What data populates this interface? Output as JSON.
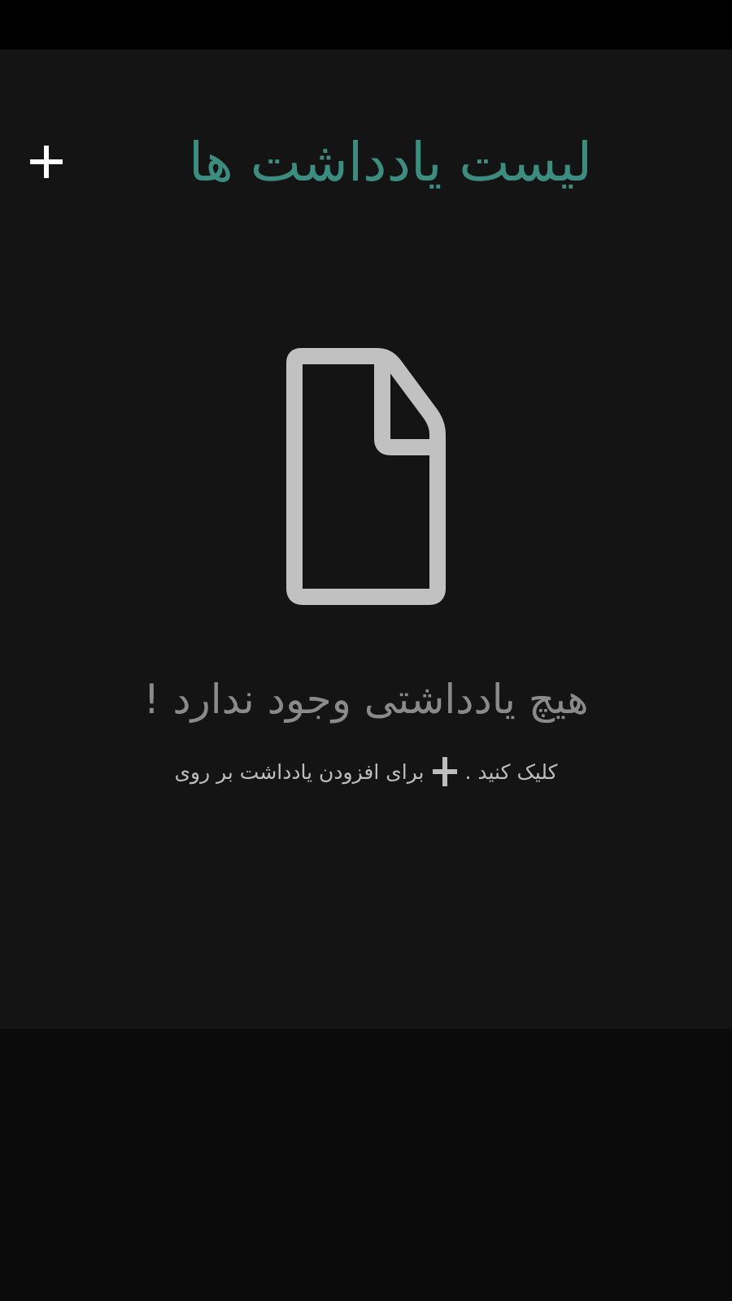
{
  "header": {
    "title": "لیست یادداشت ها",
    "title_color": "#3c8c80",
    "add_icon": "plus-icon"
  },
  "empty_state": {
    "icon": "file-icon",
    "title": "هیچ یادداشتی وجود ندارد !",
    "hint_before": "برای افزودن یادداشت بر روی",
    "hint_icon": "plus-icon",
    "hint_after": "کلیک کنید ."
  },
  "colors": {
    "background": "#141414",
    "status_bar": "#000000",
    "icon_gray": "#c1c1c1",
    "muted_text": "#8a8a8a"
  }
}
